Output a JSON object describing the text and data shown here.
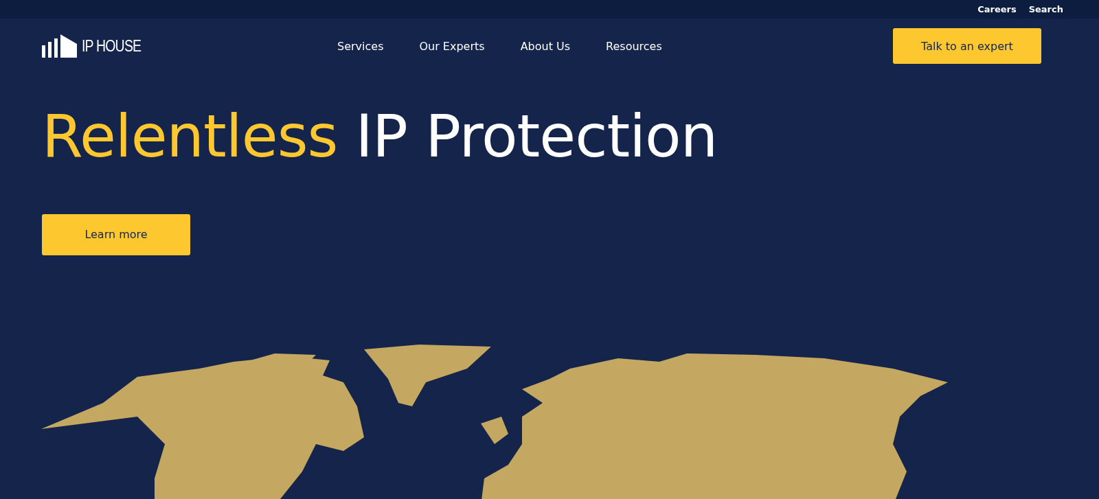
{
  "top_bar": {
    "links": [
      "Careers",
      "Search"
    ]
  },
  "header": {
    "logo": "IP HOUSE",
    "nav": [
      "Services",
      "Our Experts",
      "About Us",
      "Resources"
    ],
    "cta": "Talk to an expert"
  },
  "hero": {
    "headline_accent": "Relentless",
    "headline_rest": "IP Protection",
    "button": "Learn more"
  }
}
